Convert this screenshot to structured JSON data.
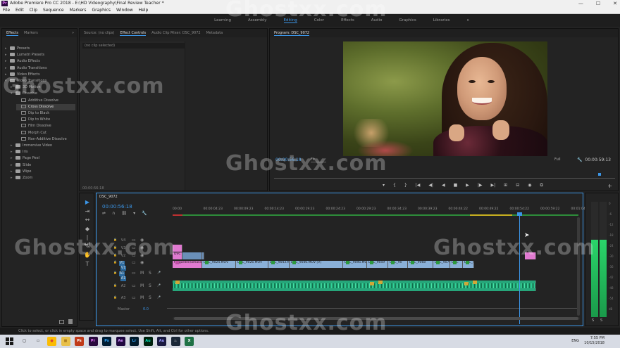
{
  "window": {
    "title": "Adobe Premiere Pro CC 2018 - E:\\HD Videography\\Final Review Teacher *",
    "app_icon": "Pr",
    "controls": [
      "—",
      "☐",
      "✕"
    ]
  },
  "menu": [
    "File",
    "Edit",
    "Clip",
    "Sequence",
    "Markers",
    "Graphics",
    "Window",
    "Help"
  ],
  "workspaces": {
    "items": [
      "Learning",
      "Assembly",
      "Editing",
      "Color",
      "Effects",
      "Audio",
      "Graphics",
      "Libraries"
    ],
    "active": "Editing",
    "more": "»"
  },
  "effects_panel": {
    "tabs": [
      "Effects",
      "Markers"
    ],
    "more": "»",
    "items": [
      {
        "label": "Presets",
        "type": "folder",
        "depth": 0
      },
      {
        "label": "Lumetri Presets",
        "type": "folder",
        "depth": 0
      },
      {
        "label": "Audio Effects",
        "type": "folder",
        "depth": 0
      },
      {
        "label": "Audio Transitions",
        "type": "folder",
        "depth": 0
      },
      {
        "label": "Video Effects",
        "type": "folder",
        "depth": 0
      },
      {
        "label": "Video Transitions",
        "type": "folder",
        "depth": 0,
        "open": true
      },
      {
        "label": "3D Motion",
        "type": "folder",
        "depth": 1
      },
      {
        "label": "Dissolve",
        "type": "folder",
        "depth": 1,
        "open": true
      },
      {
        "label": "Additive Dissolve",
        "type": "effect",
        "depth": 2
      },
      {
        "label": "Cross Dissolve",
        "type": "effect",
        "depth": 2,
        "selected": true
      },
      {
        "label": "Dip to Black",
        "type": "effect",
        "depth": 2
      },
      {
        "label": "Dip to White",
        "type": "effect",
        "depth": 2
      },
      {
        "label": "Film Dissolve",
        "type": "effect",
        "depth": 2
      },
      {
        "label": "Morph Cut",
        "type": "effect",
        "depth": 2
      },
      {
        "label": "Non-Additive Dissolve",
        "type": "effect",
        "depth": 2
      },
      {
        "label": "Immersive Video",
        "type": "folder",
        "depth": 1
      },
      {
        "label": "Iris",
        "type": "folder",
        "depth": 1
      },
      {
        "label": "Page Peel",
        "type": "folder",
        "depth": 1
      },
      {
        "label": "Slide",
        "type": "folder",
        "depth": 1
      },
      {
        "label": "Wipe",
        "type": "folder",
        "depth": 1
      },
      {
        "label": "Zoom",
        "type": "folder",
        "depth": 1
      }
    ],
    "footer_icons": [
      "new-bin",
      "delete"
    ]
  },
  "source_panel": {
    "tabs": [
      "Source: (no clips)",
      "Effect Controls",
      "Audio Clip Mixer: DSC_9072",
      "Metadata"
    ],
    "active": "Effect Controls",
    "no_clip": "(no clip selected)",
    "timecode": "00:00:56:18"
  },
  "program": {
    "tab": "Program: DSC_9072",
    "timecode": "00:00:56:18",
    "fit": "Fit",
    "resolution": "Full",
    "duration": "00:00:59:13",
    "controls": [
      "▾",
      "{",
      "}",
      "|◀",
      "◀|",
      "◀",
      "■",
      "▶",
      "|▶",
      "▶|",
      "⊞",
      "⊟",
      "◉",
      "⧉"
    ],
    "add": "+"
  },
  "tools": [
    "▶",
    "⇥",
    "↔",
    "◆",
    "|↔|",
    "✎",
    "✋",
    "T"
  ],
  "timeline": {
    "sequence_tab": "DSC_9072",
    "timecode": "00:00:56:18",
    "ruler": [
      "00:00",
      "00:00:04:23",
      "00:00:09:23",
      "00:00:14:23",
      "00:00:19:23",
      "00:00:24:23",
      "00:00:29:23",
      "00:00:34:23",
      "00:00:39:23",
      "00:00:44:22",
      "00:00:49:22",
      "00:00:54:22",
      "00:00:59:22",
      "00:01:04:2"
    ],
    "tracks_video": [
      "V4",
      "V3",
      "V2",
      "V1"
    ],
    "tracks_audio": [
      "A1",
      "A2",
      "A3"
    ],
    "src_video": "V1",
    "src_audio": "A1",
    "master_label": "Master",
    "master_value": "0.0",
    "v1_clips": [
      {
        "label": "fallgarden/amara",
        "color": "pink"
      },
      {
        "label": "DSC_9024.MOV",
        "color": "v"
      },
      {
        "label": "DSC_9026.MOV",
        "color": "v"
      },
      {
        "label": "DSC_9043.MOV",
        "color": "v"
      },
      {
        "label": "DSC_9046.MOV [V]",
        "color": "v"
      },
      {
        "label": "DSC_9095.MOV",
        "color": "v"
      },
      {
        "label": "DSC_9059",
        "color": "v"
      },
      {
        "label": "DSC_90",
        "color": "v"
      },
      {
        "label": "DSC_9068",
        "color": "v"
      },
      {
        "label": "DSC_9070",
        "color": "v"
      },
      {
        "label": "DSC",
        "color": "v"
      },
      {
        "label": "DSC_90",
        "color": "v"
      }
    ],
    "v2_clips": [
      {
        "label": "DSC",
        "color": "pink"
      },
      {
        "label": "",
        "color": "v"
      }
    ],
    "v3_clips": [
      {
        "label": "",
        "color": "pink"
      }
    ]
  },
  "meters": {
    "scale": [
      "0",
      "-6",
      "-12",
      "-18",
      "-24",
      "-30",
      "-36",
      "-42",
      "-48",
      "-54",
      "dB"
    ],
    "solo": [
      "S",
      "S"
    ]
  },
  "status": "Click to select, or click in empty space and drag to marquee select. Use Shift, Alt, and Ctrl for other options.",
  "taskbar": {
    "apps": [
      {
        "label": "◯",
        "bg": "#d7dbe4",
        "fg": "#111"
      },
      {
        "label": "▭",
        "bg": "#d7dbe4",
        "fg": "#111"
      },
      {
        "label": "●",
        "bg": "#fbbc04",
        "fg": "#db4437"
      },
      {
        "label": "■",
        "bg": "#e8c04a",
        "fg": "#b08020"
      },
      {
        "label": "Ps",
        "bg": "#c03a1a",
        "fg": "#fff"
      },
      {
        "label": "Pr",
        "bg": "#2a0a3f",
        "fg": "#ea77ff"
      },
      {
        "label": "Ps",
        "bg": "#001d34",
        "fg": "#31a8ff"
      },
      {
        "label": "Ae",
        "bg": "#1f0740",
        "fg": "#d291ff"
      },
      {
        "label": "Lr",
        "bg": "#001a2c",
        "fg": "#31a8ff"
      },
      {
        "label": "Au",
        "bg": "#00220e",
        "fg": "#00e4bb"
      },
      {
        "label": "Au",
        "bg": "#1a1a40",
        "fg": "#9999ff"
      },
      {
        "label": "♨",
        "bg": "#1b2838",
        "fg": "#ddd"
      },
      {
        "label": "X",
        "bg": "#1e7145",
        "fg": "#fff"
      }
    ],
    "time": "7:55 PM",
    "date": "10/15/2018",
    "lang": "ENG"
  },
  "watermark": "Ghostxx.com"
}
